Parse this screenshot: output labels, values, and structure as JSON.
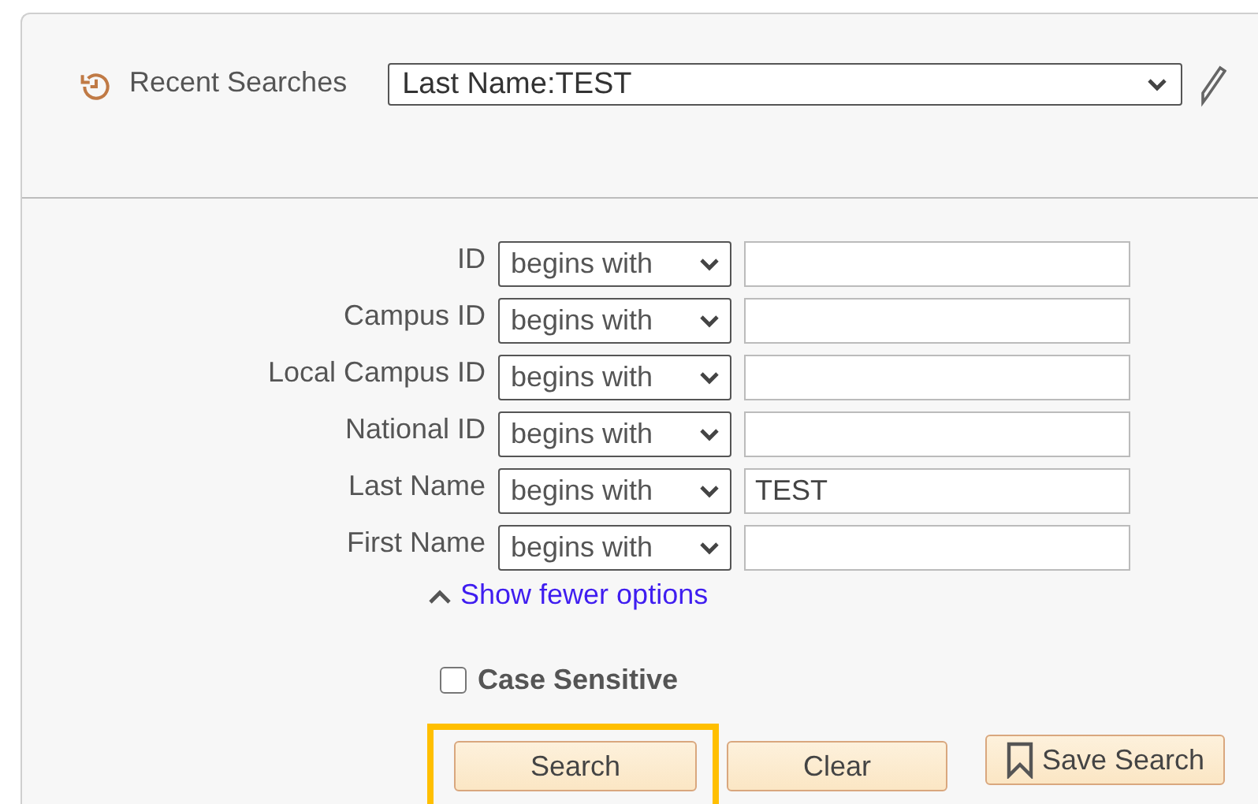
{
  "recent_searches": {
    "label": "Recent Searches",
    "value": "Last Name:TEST"
  },
  "criteria": [
    {
      "label": "ID",
      "operator": "begins with"
    },
    {
      "label": "Campus ID",
      "operator": "begins with"
    },
    {
      "label": "Local Campus ID",
      "operator": "begins with"
    },
    {
      "label": "National ID",
      "operator": "begins with"
    },
    {
      "label": "Last Name",
      "operator": "begins with",
      "value": "TEST"
    },
    {
      "label": "First Name",
      "operator": "begins with"
    }
  ],
  "options_link": {
    "label": "Show fewer options",
    "expanded": true
  },
  "case_sensitive": {
    "label": "Case Sensitive",
    "checked": false
  },
  "buttons": [
    {
      "label": "Search",
      "kind": "plain",
      "focused": true
    },
    {
      "label": "Clear",
      "kind": "plain",
      "focused": false
    },
    {
      "label": "Save Search",
      "kind": "bookmark",
      "focused": false
    }
  ]
}
